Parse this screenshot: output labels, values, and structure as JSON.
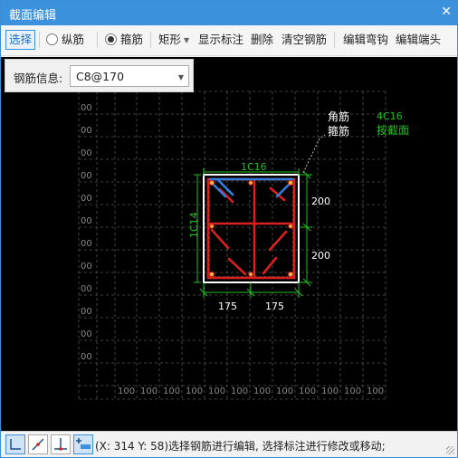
{
  "window": {
    "title": "截面编辑",
    "close_glyph": "✕"
  },
  "toolbar": {
    "select_label": "选择",
    "longitudinal_label": "纵筋",
    "stirrup_label": "箍筋",
    "shape_label": "矩形",
    "show_annotation_label": "显示标注",
    "delete_label": "删除",
    "clear_rebar_label": "清空钢筋",
    "edit_hook_label": "编辑弯钩",
    "edit_end_label": "编辑端头"
  },
  "rebar_info": {
    "label": "钢筋信息:",
    "value": "C8@170"
  },
  "drawing": {
    "corner_note_line1": "角筋",
    "corner_note_line2": "箍筋",
    "corner_note_value": "4C16",
    "corner_note_sub": "按截面",
    "top_bar": "1C16",
    "side_bar": "1C14",
    "dim_right_top": "200",
    "dim_right_bottom": "200",
    "dim_bottom_left": "175",
    "dim_bottom_right": "175",
    "grid_left_labels": [
      "00",
      "00",
      "00",
      "00",
      "00",
      "00",
      "00",
      "00",
      "00",
      "00",
      "00",
      "00"
    ],
    "grid_bottom_labels": [
      "100",
      "100",
      "100",
      "100",
      "100",
      "100",
      "100",
      "100",
      "100",
      "100",
      "100",
      "100"
    ]
  },
  "status": {
    "text": "(X: 314 Y: 58)选择钢筋进行编辑, 选择标注进行修改或移动;"
  },
  "colors": {
    "titlebar": "#3c91dc",
    "rebar_red": "#d9201f",
    "rebar_blue": "#2f7fe0",
    "dim_green": "#22c022"
  }
}
